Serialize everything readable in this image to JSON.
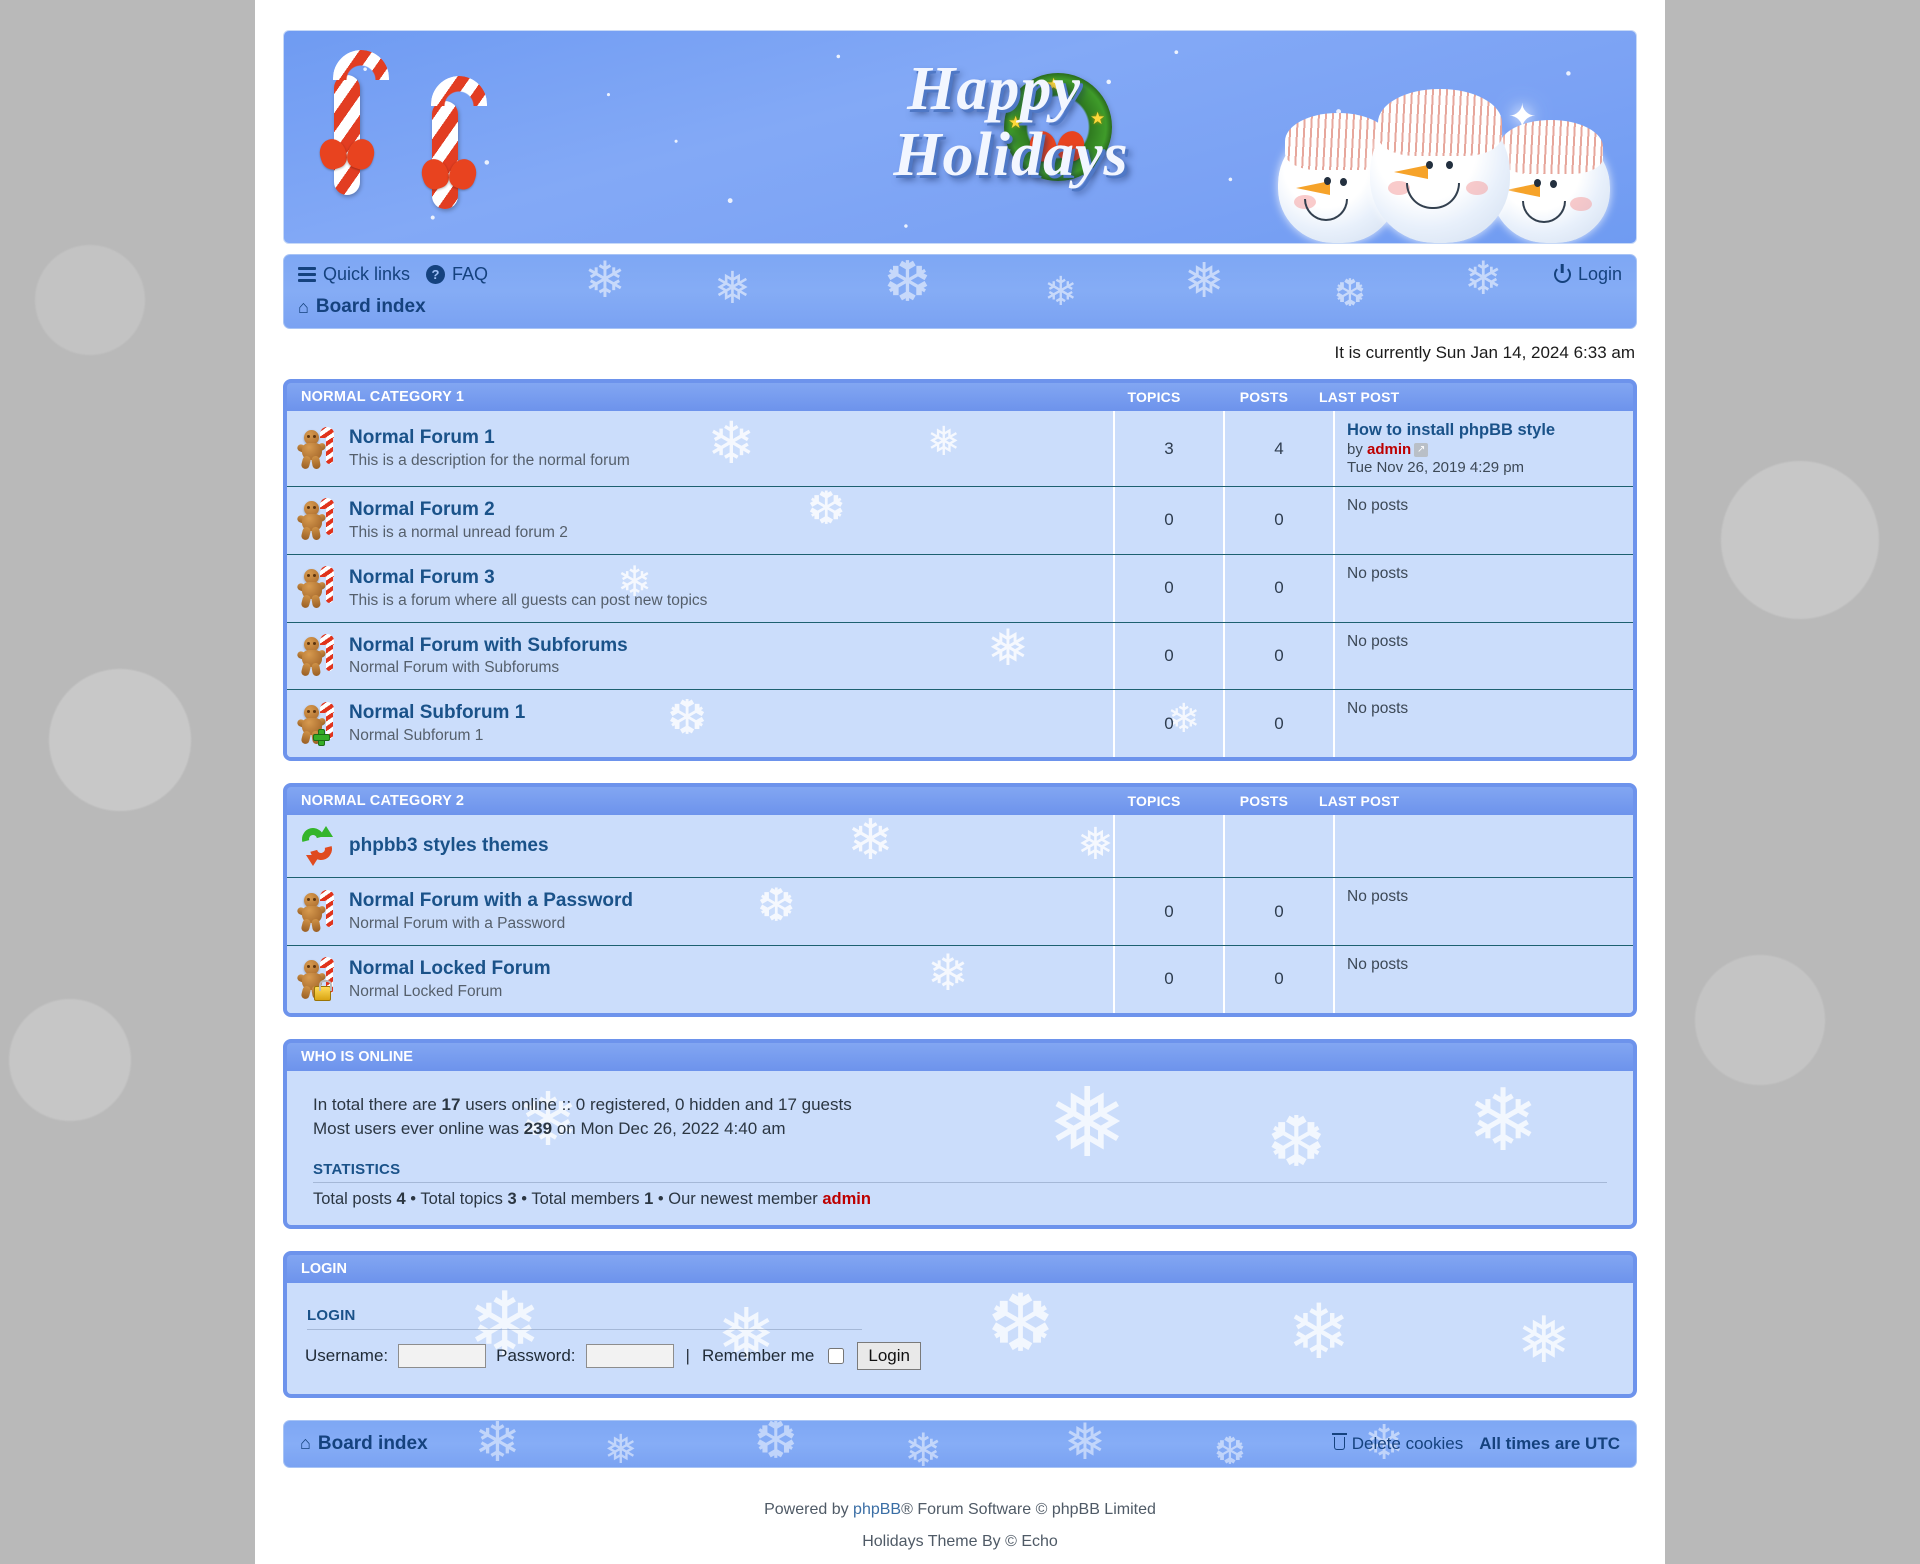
{
  "banner": {
    "title_line1": "Happy",
    "title_line2": "Holidays"
  },
  "nav": {
    "quick_links": "Quick links",
    "faq": "FAQ",
    "login": "Login",
    "board_index": "Board index"
  },
  "current_time": "It is currently Sun Jan 14, 2024 6:33 am",
  "columns": {
    "topics": "TOPICS",
    "posts": "POSTS",
    "last_post": "LAST POST"
  },
  "categories": [
    {
      "title": "NORMAL CATEGORY 1",
      "forums": [
        {
          "icon": "gingerbread-icon",
          "name": "Normal Forum 1",
          "desc": "This is a description for the normal forum",
          "topics": "3",
          "posts": "4",
          "last_post": {
            "title": "How to install phpBB style",
            "by_label": "by",
            "user": "admin",
            "date": "Tue Nov 26, 2019 4:29 pm"
          }
        },
        {
          "icon": "gingerbread-icon",
          "name": "Normal Forum 2",
          "desc": "This is a normal unread forum 2",
          "topics": "0",
          "posts": "0",
          "last_post": {
            "no_posts": "No posts"
          }
        },
        {
          "icon": "gingerbread-icon",
          "name": "Normal Forum 3",
          "desc": "This is a forum where all guests can post new topics",
          "topics": "0",
          "posts": "0",
          "last_post": {
            "no_posts": "No posts"
          }
        },
        {
          "icon": "gingerbread-icon",
          "name": "Normal Forum with Subforums",
          "desc": "Normal Forum with Subforums",
          "topics": "0",
          "posts": "0",
          "last_post": {
            "no_posts": "No posts"
          }
        },
        {
          "icon": "gingerbread-subforum-icon",
          "name": "Normal Subforum 1",
          "desc": "Normal Subforum 1",
          "topics": "0",
          "posts": "0",
          "last_post": {
            "no_posts": "No posts"
          }
        }
      ]
    },
    {
      "title": "NORMAL CATEGORY 2",
      "forums": [
        {
          "icon": "redirect-arrows-icon",
          "name": "phpbb3 styles themes",
          "desc": "",
          "topics": "",
          "posts": "",
          "last_post": {}
        },
        {
          "icon": "gingerbread-icon",
          "name": "Normal Forum with a Password",
          "desc": "Normal Forum with a Password",
          "topics": "0",
          "posts": "0",
          "last_post": {
            "no_posts": "No posts"
          }
        },
        {
          "icon": "gingerbread-locked-icon",
          "name": "Normal Locked Forum",
          "desc": "Normal Locked Forum",
          "topics": "0",
          "posts": "0",
          "last_post": {
            "no_posts": "No posts"
          }
        }
      ]
    }
  ],
  "who_is_online": {
    "heading": "WHO IS ONLINE",
    "total_prefix": "In total there are",
    "total_count": "17",
    "total_suffix": "users online :: 0 registered, 0 hidden and 17 guests",
    "record_prefix": "Most users ever online was",
    "record_count": "239",
    "record_suffix": "on Mon Dec 26, 2022 4:40 am"
  },
  "statistics": {
    "heading": "STATISTICS",
    "total_posts_label": "Total posts",
    "total_posts": "4",
    "total_topics_label": "Total topics",
    "total_topics": "3",
    "total_members_label": "Total members",
    "total_members": "1",
    "newest_member_label": "Our newest member",
    "newest_member": "admin",
    "bullet": "•"
  },
  "login_panel": {
    "heading": "LOGIN",
    "sub_heading": "LOGIN",
    "username_label": "Username:",
    "password_label": "Password:",
    "username_value": "",
    "password_value": "",
    "separator": "|",
    "remember_label": "Remember me",
    "button": "Login"
  },
  "footer": {
    "board_index": "Board index",
    "delete_cookies": "Delete cookies",
    "all_times": "All times are UTC",
    "powered_prefix": "Powered by",
    "powered_link": "phpBB",
    "powered_suffix": "® Forum Software © phpBB Limited",
    "theme_credit": "Holidays Theme By © Echo"
  },
  "colors": {
    "accent_blue": "#6d93ec",
    "row_bg": "#cbddfb",
    "link_blue": "#1a5289",
    "user_red": "#bd0000",
    "nav_text": "#15427e"
  }
}
